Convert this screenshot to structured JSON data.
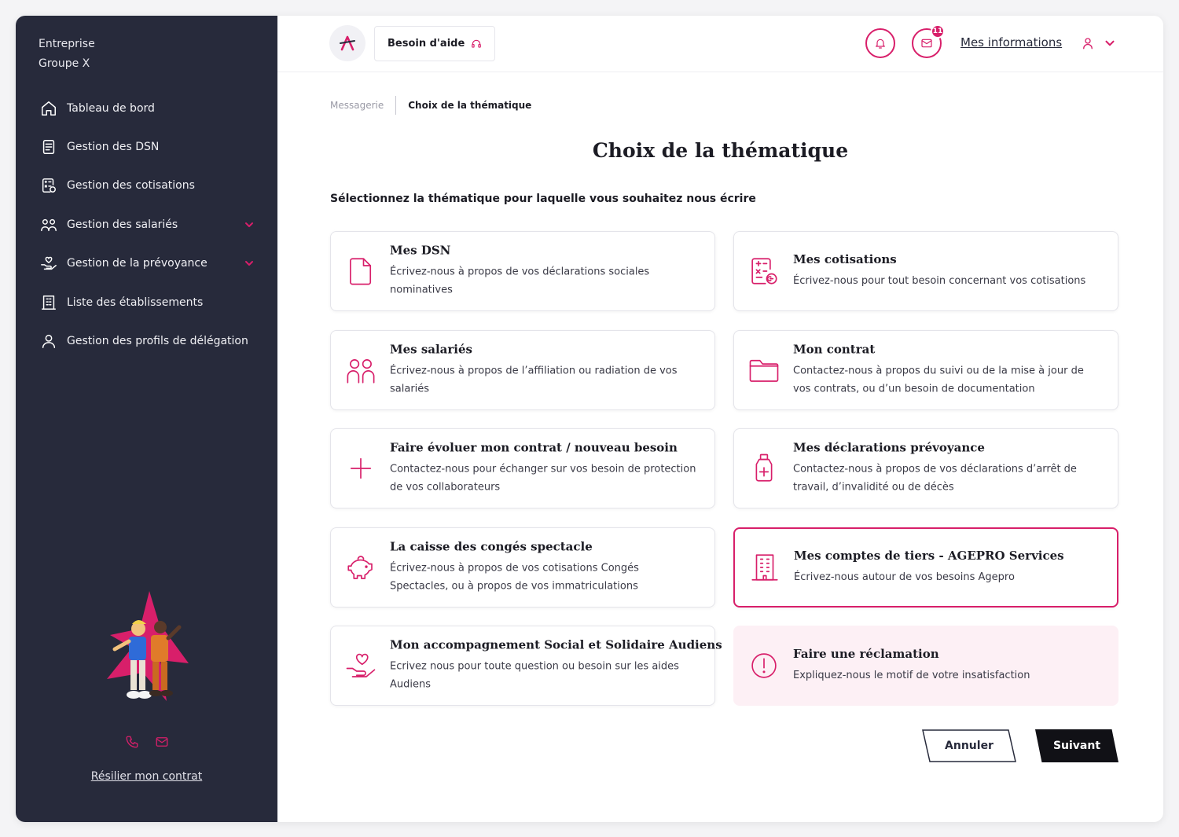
{
  "sidebar": {
    "org_line1": "Entreprise",
    "org_line2": "Groupe X",
    "items": [
      {
        "label": "Tableau de bord",
        "icon": "home-icon"
      },
      {
        "label": "Gestion des DSN",
        "icon": "document-icon"
      },
      {
        "label": "Gestion des cotisations",
        "icon": "calculator-document-icon"
      },
      {
        "label": "Gestion des salariés",
        "icon": "people-icon",
        "expandable": true
      },
      {
        "label": "Gestion de la prévoyance",
        "icon": "hand-heart-icon",
        "expandable": true
      },
      {
        "label": "Liste des établissements",
        "icon": "building-icon"
      },
      {
        "label": "Gestion des profils de délégation",
        "icon": "user-icon"
      }
    ],
    "resilier": "Résilier mon contrat"
  },
  "header": {
    "help_label": "Besoin d'aide",
    "notification_count": "11",
    "mes_informations": "Mes informations"
  },
  "breadcrumb": {
    "parent": "Messagerie",
    "current": "Choix de la thématique"
  },
  "main": {
    "title": "Choix de la thématique",
    "subtitle": "Sélectionnez la thématique pour laquelle vous souhaitez nous écrire",
    "cards": [
      {
        "title": "Mes DSN",
        "desc": "Écrivez-nous à propos de vos déclarations sociales nominatives",
        "icon": "file-icon"
      },
      {
        "title": "Mes cotisations",
        "desc": "Écrivez-nous pour tout besoin concernant vos cotisations",
        "icon": "calculator-document-icon"
      },
      {
        "title": "Mes salariés",
        "desc": "Écrivez-nous à propos de l’affiliation ou radiation de vos salariés",
        "icon": "people-icon"
      },
      {
        "title": "Mon contrat",
        "desc": "Contactez-nous à propos du suivi ou de la mise à jour de vos contrats, ou d’un besoin de documentation",
        "icon": "folder-icon"
      },
      {
        "title": "Faire évoluer mon contrat / nouveau besoin",
        "desc": "Contactez-nous pour échanger sur vos besoin de protection de vos collaborateurs",
        "icon": "plus-icon"
      },
      {
        "title": "Mes déclarations prévoyance",
        "desc": "Contactez-nous à propos de vos déclarations d’arrêt de travail, d’invalidité ou de décès",
        "icon": "medicine-bottle-icon"
      },
      {
        "title": "La caisse des congés spectacle",
        "desc": "Écrivez-nous à propos de vos cotisations Congés Spectacles, ou à propos de vos immatriculations",
        "icon": "piggy-bank-icon"
      },
      {
        "title": "Mes comptes de tiers - AGEPRO Services",
        "desc": "Écrivez-nous autour de vos besoins Agepro",
        "icon": "building-icon",
        "selected": true
      },
      {
        "title": "Mon accompagnement Social et Solidaire Audiens",
        "desc": "Ecrivez nous pour toute question ou besoin sur les aides Audiens",
        "icon": "hand-heart-icon"
      },
      {
        "title": "Faire une réclamation",
        "desc": "Expliquez-nous le motif de votre insatisfaction",
        "icon": "alert-circle-icon"
      }
    ],
    "cancel_label": "Annuler",
    "next_label": "Suivant"
  },
  "colors": {
    "accent": "#d81f6a",
    "sidebar_bg": "#272a3b",
    "pink_bg": "#fdf0f5"
  }
}
